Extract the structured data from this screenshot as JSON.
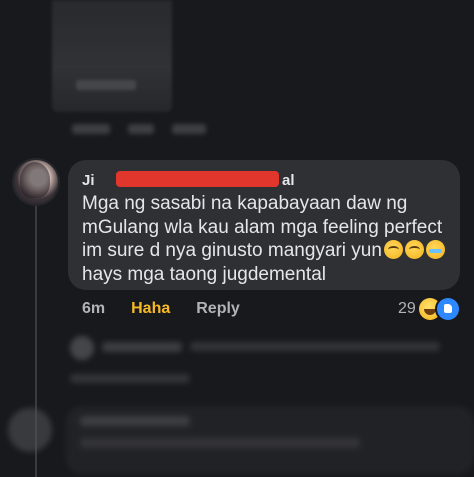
{
  "comment": {
    "author_visible_prefix": "Ji",
    "author_visible_suffix": "al",
    "lines": [
      "Mga ng sasabi na kapabayaan daw ng",
      "mGulang wla kau alam mga feeling perfect",
      "im sure d nya ginusto mangyari yun",
      "hays mga taong jugdemental"
    ],
    "emojis": [
      "pleading-face",
      "pleading-face",
      "loudly-crying-face"
    ]
  },
  "actions": {
    "time": "6m",
    "reaction_label": "Haha",
    "reply_label": "Reply"
  },
  "reactions": {
    "count": "29",
    "icons": [
      "haha-icon",
      "like-icon"
    ]
  },
  "colors": {
    "background": "#18191c",
    "bubble": "#2f3034",
    "text": "#e4e6eb",
    "muted": "#b0b3b8",
    "haha": "#f7b928",
    "redaction": "#e0362b",
    "like": "#2d88ff"
  }
}
